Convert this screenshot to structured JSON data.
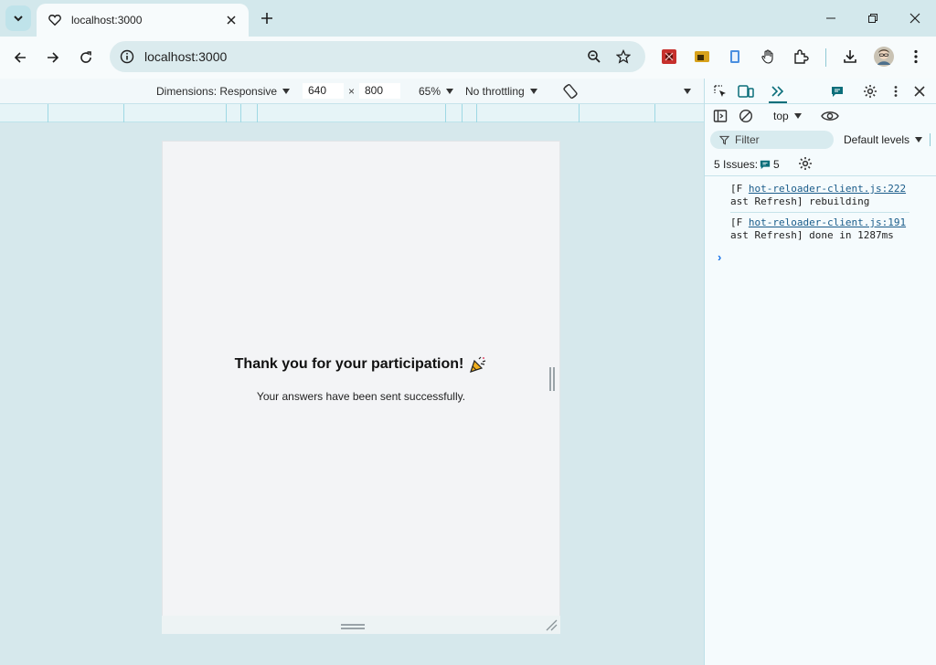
{
  "browser": {
    "tab": {
      "title": "localhost:3000"
    },
    "omnibox": {
      "url": "localhost:3000"
    }
  },
  "device_toolbar": {
    "dimensions_label": "Dimensions: Responsive",
    "width": "640",
    "height": "800",
    "times": "×",
    "zoom": "65%",
    "throttling": "No throttling"
  },
  "page": {
    "heading": "Thank you for your participation!",
    "heading_emoji": "🎉",
    "subtext": "Your answers have been sent successfully."
  },
  "devtools": {
    "context": "top",
    "filter_placeholder": "Filter",
    "levels": "Default levels",
    "issues_label": "5 Issues:",
    "issues_count": "5",
    "console": [
      {
        "prefix": "[F",
        "source": "hot-reloader-client.js:222",
        "message": "ast Refresh] rebuilding"
      },
      {
        "prefix": "[F",
        "source": "hot-reloader-client.js:191",
        "message": "ast Refresh] done in 1287ms"
      }
    ],
    "prompt_glyph": "›"
  },
  "colors": {
    "accent": "#0b6e7a",
    "tab_bg": "#d3e8ec",
    "toolbar_bg": "#f7fbfc",
    "omnibox_bg": "#dbebee"
  }
}
